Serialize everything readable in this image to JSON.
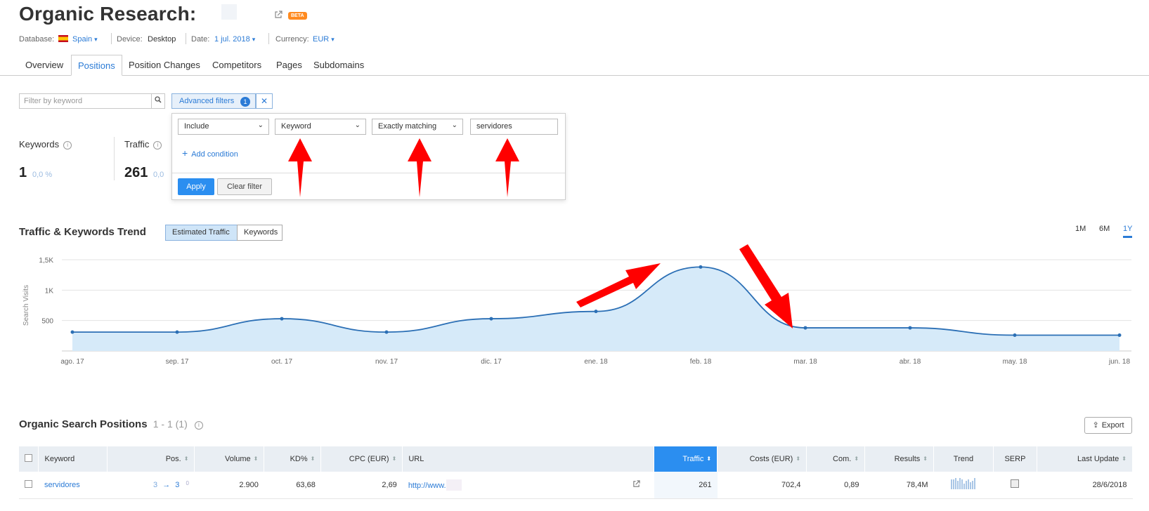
{
  "header": {
    "title": "Organic Research:",
    "beta": "BETA",
    "database_label": "Database:",
    "database_value": "Spain",
    "device_label": "Device:",
    "device_value": "Desktop",
    "date_label": "Date:",
    "date_value": "1 jul. 2018",
    "currency_label": "Currency:",
    "currency_value": "EUR"
  },
  "tabs": [
    "Overview",
    "Positions",
    "Position Changes",
    "Competitors",
    "Pages",
    "Subdomains"
  ],
  "active_tab": "Positions",
  "filter": {
    "placeholder": "Filter by keyword",
    "advanced_label": "Advanced filters",
    "advanced_count": "1"
  },
  "advanced_panel": {
    "include": "Include",
    "field": "Keyword",
    "match": "Exactly matching",
    "value": "servidores",
    "add_condition": "Add condition",
    "apply": "Apply",
    "clear": "Clear filter"
  },
  "stats": {
    "keywords_label": "Keywords",
    "keywords_value": "1",
    "keywords_pct": "0,0 %",
    "traffic_label": "Traffic",
    "traffic_value": "261",
    "traffic_pct": "0,0"
  },
  "trend": {
    "title": "Traffic & Keywords Trend",
    "toggle_traffic": "Estimated Traffic",
    "toggle_keywords": "Keywords",
    "ranges": [
      "1M",
      "6M",
      "1Y"
    ],
    "active_range": "1Y"
  },
  "chart_data": {
    "type": "area",
    "ylabel": "Search Visits",
    "ytick_labels": [
      "1,5K",
      "1K",
      "500"
    ],
    "yticks": [
      1500,
      1000,
      500
    ],
    "ylim": [
      0,
      1500
    ],
    "x": [
      "ago. 17",
      "sep. 17",
      "oct. 17",
      "nov. 17",
      "dic. 17",
      "ene. 18",
      "feb. 18",
      "mar. 18",
      "abr. 18",
      "may. 18",
      "jun. 18"
    ],
    "values": [
      310,
      310,
      530,
      310,
      530,
      650,
      1380,
      380,
      380,
      260,
      260
    ],
    "color": "#2b6fb5",
    "fill": "#d6eaf9",
    "grid": true
  },
  "positions": {
    "title": "Organic Search Positions",
    "range": "1 - 1 (1)",
    "export": "Export",
    "columns": [
      "Keyword",
      "Pos.",
      "Volume",
      "KD%",
      "CPC (EUR)",
      "URL",
      "Traffic",
      "Costs (EUR)",
      "Com.",
      "Results",
      "Trend",
      "SERP",
      "Last Update"
    ],
    "rows": [
      {
        "keyword": "servidores",
        "pos_from": "3",
        "pos_to": "3",
        "pos_change": "0",
        "volume": "2.900",
        "kd": "63,68",
        "cpc": "2,69",
        "url": "http://www.",
        "traffic": "261",
        "costs": "702,4",
        "com": "0,89",
        "results": "78,4M",
        "last_update": "28/6/2018"
      }
    ]
  }
}
